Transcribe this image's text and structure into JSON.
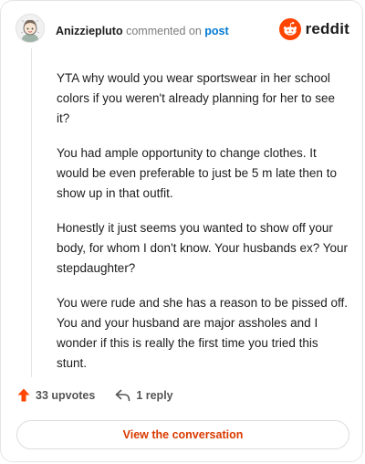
{
  "header": {
    "username": "Anizziepluto",
    "action_text": "commented on",
    "post_link": "post"
  },
  "brand": {
    "name": "reddit",
    "icon": "reddit-snoo-icon",
    "color": "#ff4500"
  },
  "comment": {
    "paragraphs": [
      "YTA why would you wear sportswear in her school colors if you weren't already planning for her to see it?",
      "You had ample opportunity to change clothes. It would be even preferable to just be 5 m late then to show up in that outfit.",
      "Honestly it just seems you wanted to show off your body, for whom I don't know. Your husbands ex? Your stepdaughter?",
      "You were rude and she has a reason to be pissed off. You and your husband are major assholes and I wonder if this is really the first time you tried this stunt."
    ]
  },
  "actions": {
    "upvotes_label": "33 upvotes",
    "upvote_icon": "upvote-arrow-icon",
    "reply_label": "1 reply",
    "reply_icon": "reply-arrow-icon"
  },
  "cta": {
    "label": "View the conversation"
  },
  "colors": {
    "accent": "#d93a00",
    "link": "#0079d3",
    "upvote": "#ff4500"
  }
}
